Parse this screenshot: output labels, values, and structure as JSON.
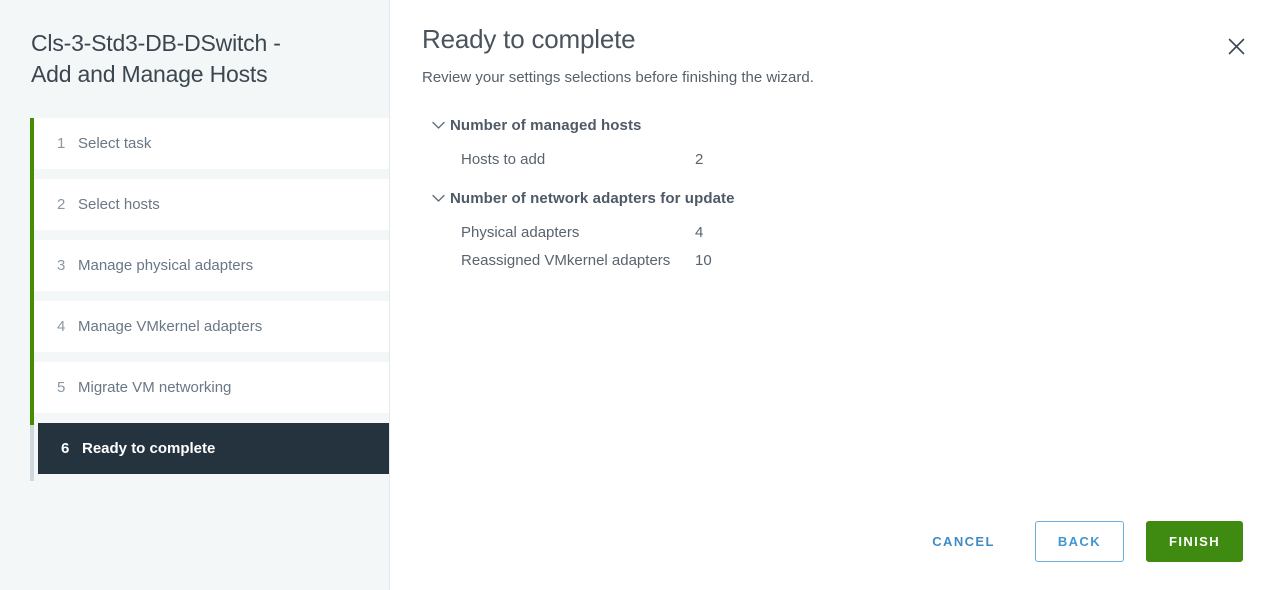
{
  "wizard": {
    "title": "Cls-3-Std3-DB-DSwitch -\nAdd and Manage Hosts",
    "close_icon": "close-icon"
  },
  "sidebar": {
    "steps": [
      {
        "number": "1",
        "label": "Select task",
        "state": "done"
      },
      {
        "number": "2",
        "label": "Select hosts",
        "state": "done"
      },
      {
        "number": "3",
        "label": "Manage physical adapters",
        "state": "done"
      },
      {
        "number": "4",
        "label": "Manage VMkernel adapters",
        "state": "done"
      },
      {
        "number": "5",
        "label": "Migrate VM networking",
        "state": "done"
      },
      {
        "number": "6",
        "label": "Ready to complete",
        "state": "active"
      }
    ]
  },
  "main": {
    "title": "Ready to complete",
    "subtitle": "Review your settings selections before finishing the wizard.",
    "groups": [
      {
        "title": "Number of managed hosts",
        "expanded": true,
        "chevron_icon": "chevron-down-icon",
        "rows": [
          {
            "key": "Hosts to add",
            "value": "2"
          }
        ]
      },
      {
        "title": "Number of network adapters for update",
        "expanded": true,
        "chevron_icon": "chevron-down-icon",
        "rows": [
          {
            "key": "Physical adapters",
            "value": "4"
          },
          {
            "key": "Reassigned VMkernel adapters",
            "value": "10"
          }
        ]
      }
    ]
  },
  "footer": {
    "cancel_label": "CANCEL",
    "back_label": "BACK",
    "finish_label": "FINISH"
  },
  "colors": {
    "accent_green": "#468c00",
    "finish_green": "#3f8a10",
    "link_blue": "#3f8cc4",
    "active_step_bg": "#25333f",
    "sidebar_bg": "#f4f7f8"
  }
}
